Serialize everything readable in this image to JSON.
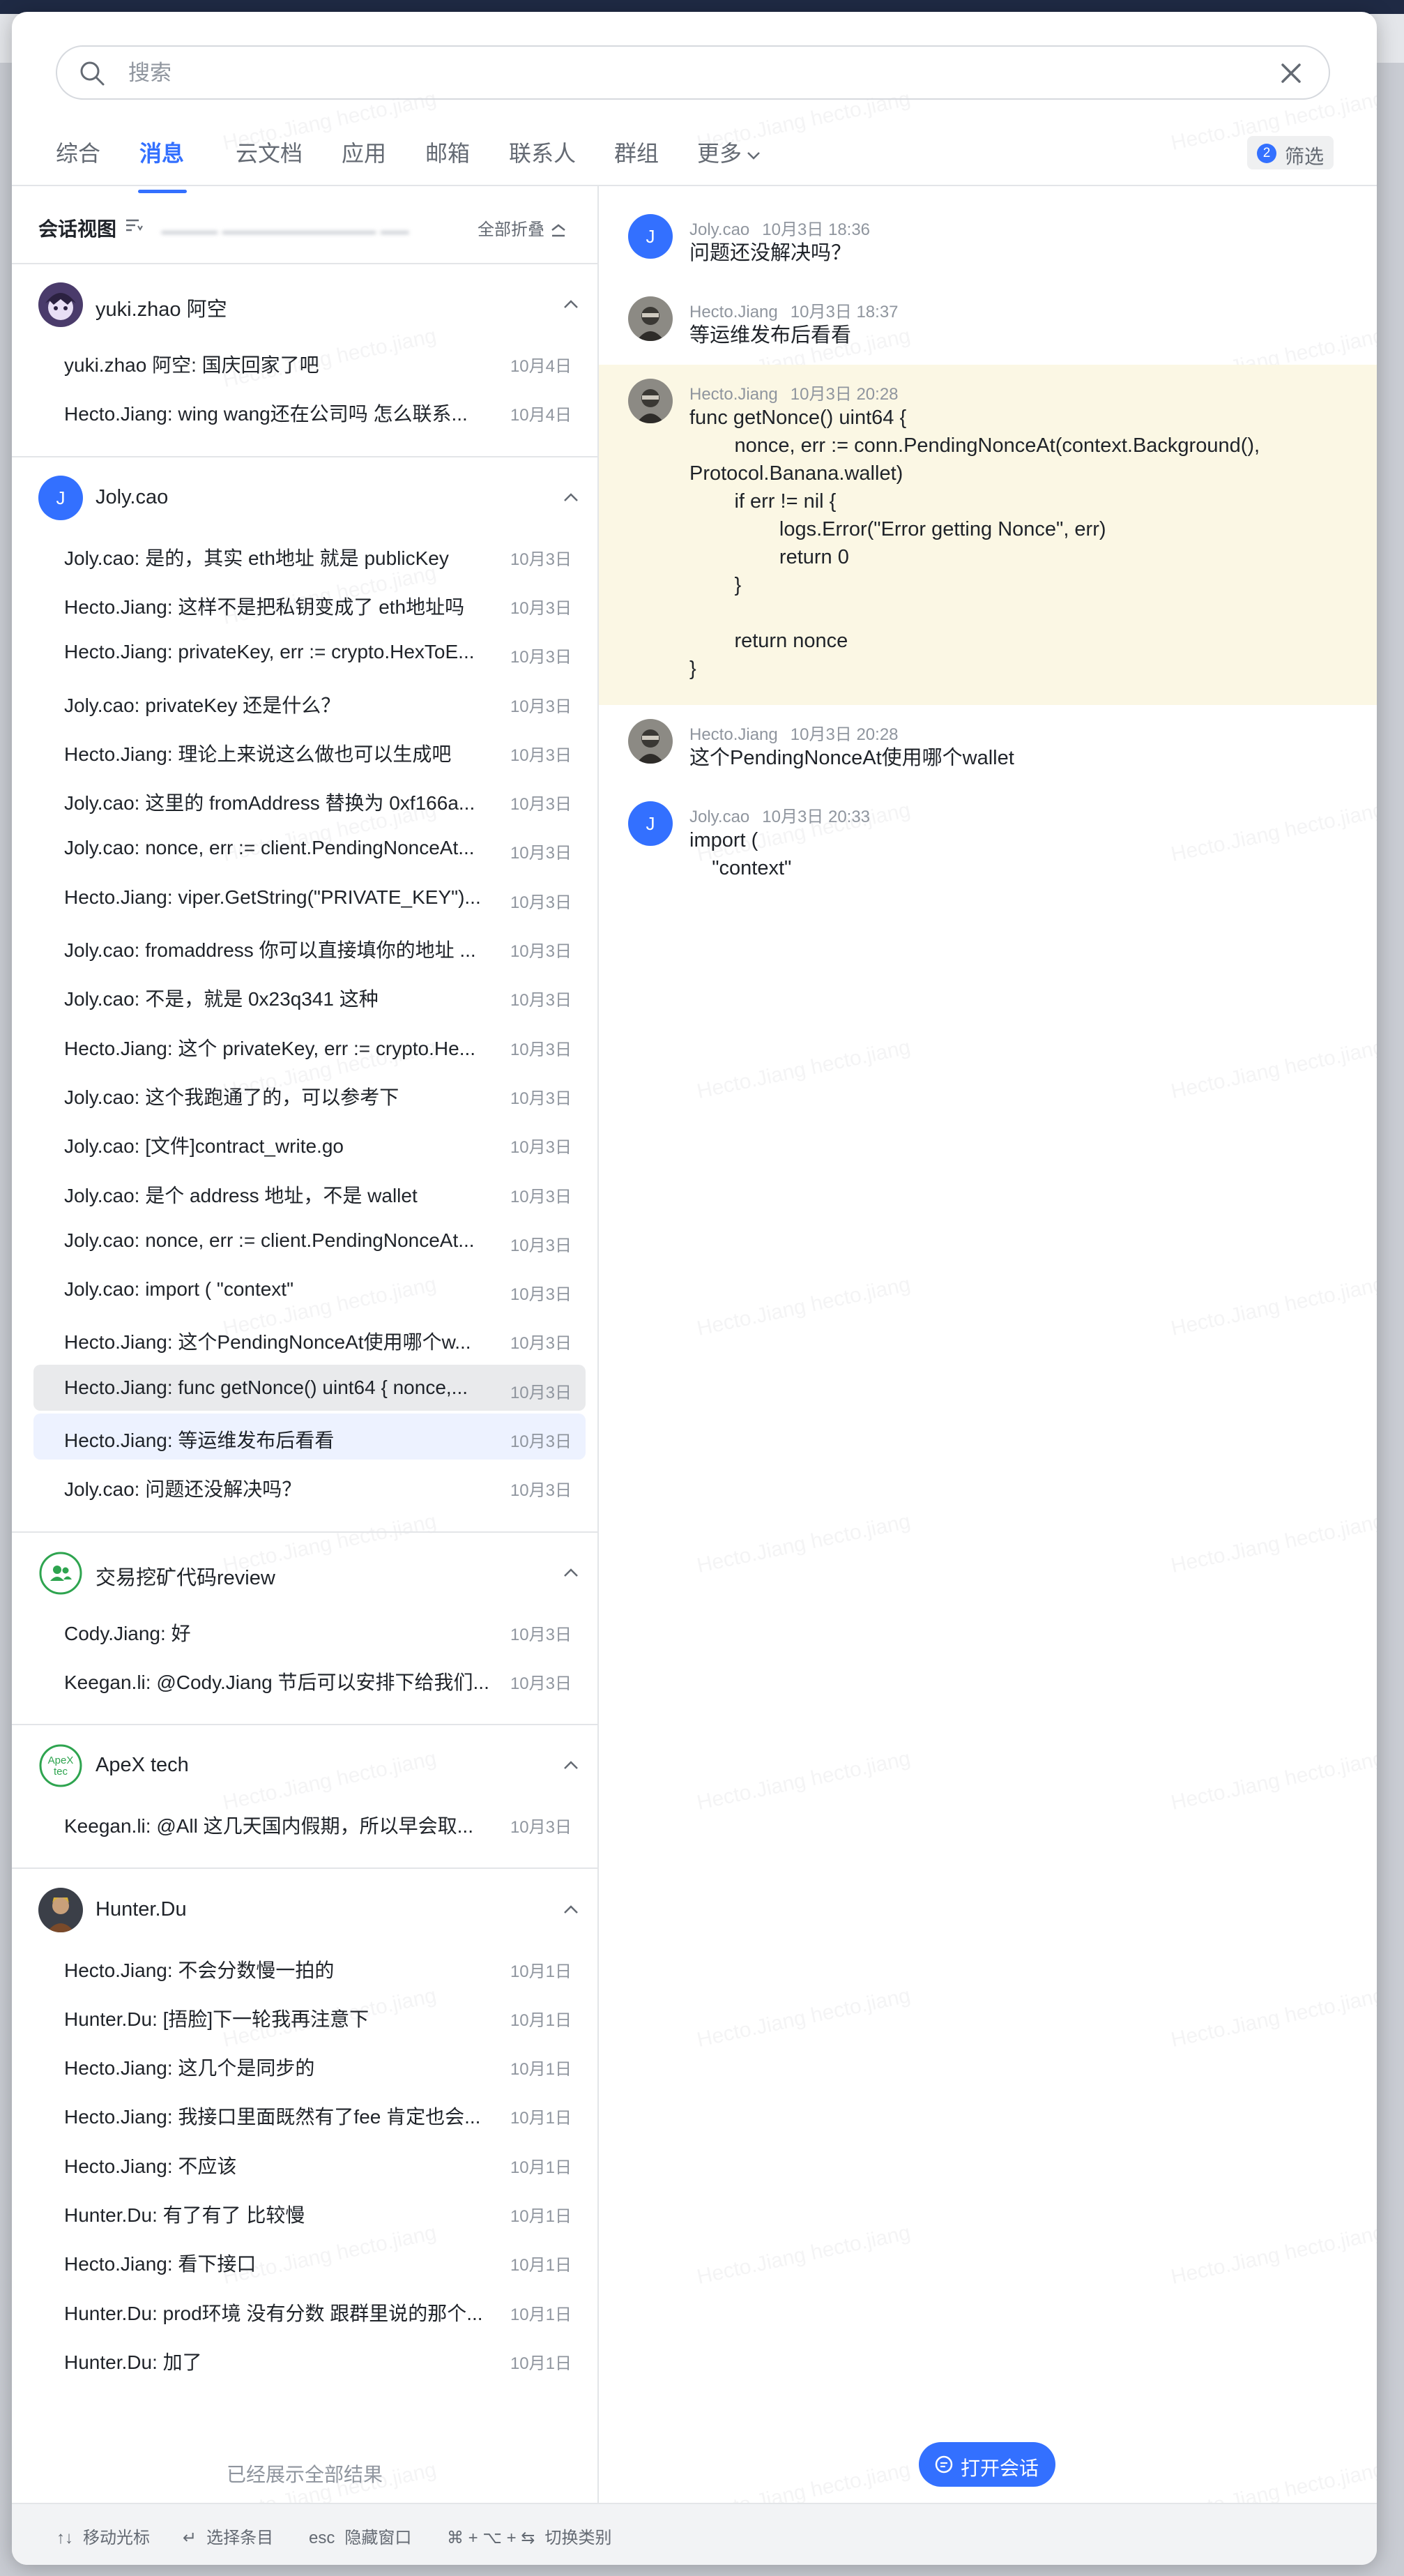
{
  "search": {
    "placeholder": "搜索",
    "value": ""
  },
  "tabs": [
    {
      "label": "综合",
      "active": false
    },
    {
      "label": "消息",
      "active": true
    },
    {
      "label": "云文档",
      "active": false
    },
    {
      "label": "应用",
      "active": false
    },
    {
      "label": "邮箱",
      "active": false
    },
    {
      "label": "联系人",
      "active": false
    },
    {
      "label": "群组",
      "active": false
    },
    {
      "label": "更多",
      "active": false
    }
  ],
  "filter": {
    "count": "2",
    "label": "筛选"
  },
  "watermark": "Hecto.Jiang hecto.jiang",
  "left_panel": {
    "title": "会话视图",
    "collapse_all": "全部折叠",
    "groups": [
      {
        "name": "yuki.zhao 阿空",
        "avatar": "anime-avatar",
        "rows": [
          {
            "text": "yuki.zhao 阿空: 国庆回家了吧",
            "date": "10月4日"
          },
          {
            "text": "Hecto.Jiang: wing wang还在公司吗 怎么联系...",
            "date": "10月4日"
          }
        ]
      },
      {
        "name": "Joly.cao",
        "avatar_letter": "J",
        "rows": [
          {
            "text": "Joly.cao: 是的，其实 eth地址 就是 publicKey",
            "date": "10月3日"
          },
          {
            "text": "Hecto.Jiang: 这样不是把私钥变成了 eth地址吗",
            "date": "10月3日"
          },
          {
            "text": "Hecto.Jiang: privateKey, err := crypto.HexToE...",
            "date": "10月3日"
          },
          {
            "text": "Joly.cao: privateKey 还是什么？",
            "date": "10月3日"
          },
          {
            "text": "Hecto.Jiang: 理论上来说这么做也可以生成吧",
            "date": "10月3日"
          },
          {
            "text": "Joly.cao: 这里的 fromAddress 替换为 0xf166a...",
            "date": "10月3日"
          },
          {
            "text": "Joly.cao: nonce, err := client.PendingNonceAt...",
            "date": "10月3日"
          },
          {
            "text": "Hecto.Jiang: viper.GetString(\"PRIVATE_KEY\")...",
            "date": "10月3日"
          },
          {
            "text": "Joly.cao: fromaddress 你可以直接填你的地址 ...",
            "date": "10月3日"
          },
          {
            "text": "Joly.cao: 不是，就是 0x23q341 这种",
            "date": "10月3日"
          },
          {
            "text": "Hecto.Jiang: 这个 privateKey, err := crypto.He...",
            "date": "10月3日"
          },
          {
            "text": "Joly.cao: 这个我跑通了的，可以参考下",
            "date": "10月3日"
          },
          {
            "text": "Joly.cao: [文件]contract_write.go",
            "date": "10月3日"
          },
          {
            "text": "Joly.cao: 是个 address 地址，不是 wallet",
            "date": "10月3日"
          },
          {
            "text": "Joly.cao: nonce, err := client.PendingNonceAt...",
            "date": "10月3日"
          },
          {
            "text": "Joly.cao: import ( \"context\"",
            "date": "10月3日"
          },
          {
            "text": "Hecto.Jiang: 这个PendingNonceAt使用哪个w...",
            "date": "10月3日"
          },
          {
            "text": "Hecto.Jiang: func getNonce() uint64 { nonce,...",
            "date": "10月3日",
            "highlight": "grey"
          },
          {
            "text": "Hecto.Jiang: 等运维发布后看看",
            "date": "10月3日",
            "highlight": "blue"
          },
          {
            "text": "Joly.cao: 问题还没解决吗？",
            "date": "10月3日"
          }
        ]
      },
      {
        "name": "交易挖矿代码review",
        "avatar": "group-icon",
        "rows": [
          {
            "text": "Cody.Jiang: 好",
            "date": "10月3日"
          },
          {
            "text": "Keegan.li: @Cody.Jiang 节后可以安排下给我们...",
            "date": "10月3日"
          }
        ]
      },
      {
        "name": "ApeX tech",
        "avatar_text": "ApeX tec",
        "rows": [
          {
            "text": "Keegan.li: @All 这几天国内假期，所以早会取...",
            "date": "10月3日"
          }
        ]
      },
      {
        "name": "Hunter.Du",
        "avatar": "person-avatar",
        "rows": [
          {
            "text": "Hecto.Jiang: 不会分数慢一拍的",
            "date": "10月1日"
          },
          {
            "text": "Hunter.Du: [捂脸]下一轮我再注意下",
            "date": "10月1日"
          },
          {
            "text": "Hecto.Jiang: 这几个是同步的",
            "date": "10月1日"
          },
          {
            "text": "Hecto.Jiang: 我接口里面既然有了fee 肯定也会...",
            "date": "10月1日"
          },
          {
            "text": "Hecto.Jiang: 不应该",
            "date": "10月1日"
          },
          {
            "text": "Hunter.Du: 有了有了 比较慢",
            "date": "10月1日"
          },
          {
            "text": "Hecto.Jiang: 看下接口",
            "date": "10月1日"
          },
          {
            "text": "Hunter.Du: prod环境 没有分数 跟群里说的那个...",
            "date": "10月1日"
          },
          {
            "text": "Hunter.Du: 加了",
            "date": "10月1日"
          }
        ]
      }
    ],
    "end_note": "已经展示全部结果"
  },
  "messages": [
    {
      "sender": "Joly.cao",
      "time": "10月3日 18:36",
      "avatar_letter": "J",
      "body": "问题还没解决吗？"
    },
    {
      "sender": "Hecto.Jiang",
      "time": "10月3日 18:37",
      "avatar": "photo-avatar",
      "body": "等运维发布后看看"
    },
    {
      "sender": "Hecto.Jiang",
      "time": "10月3日 20:28",
      "avatar": "photo-avatar",
      "highlight": true,
      "body": "func getNonce() uint64 {\n        nonce, err := conn.PendingNonceAt(context.Background(),\nProtocol.Banana.wallet)\n        if err != nil {\n                logs.Error(\"Error getting Nonce\", err)\n                return 0\n        }\n\n        return nonce\n}"
    },
    {
      "sender": "Hecto.Jiang",
      "time": "10月3日 20:28",
      "avatar": "photo-avatar",
      "body": "这个PendingNonceAt使用哪个wallet"
    },
    {
      "sender": "Joly.cao",
      "time": "10月3日 20:33",
      "avatar_letter": "J",
      "body": "import (\n    \"context\""
    }
  ],
  "open_chat_button": "打开会话",
  "footer": [
    {
      "key": "↑↓",
      "label": "移动光标"
    },
    {
      "key": "↵",
      "label": "选择条目"
    },
    {
      "key": "esc",
      "label": "隐藏窗口"
    },
    {
      "key": "⌘ + ⌥ + ⇆",
      "label": "切换类别"
    }
  ],
  "colors": {
    "accent": "#3370ff",
    "highlight_message": "#fbf7e4",
    "selected_row": "#edf2ff",
    "hover_row": "#e9eaec"
  }
}
